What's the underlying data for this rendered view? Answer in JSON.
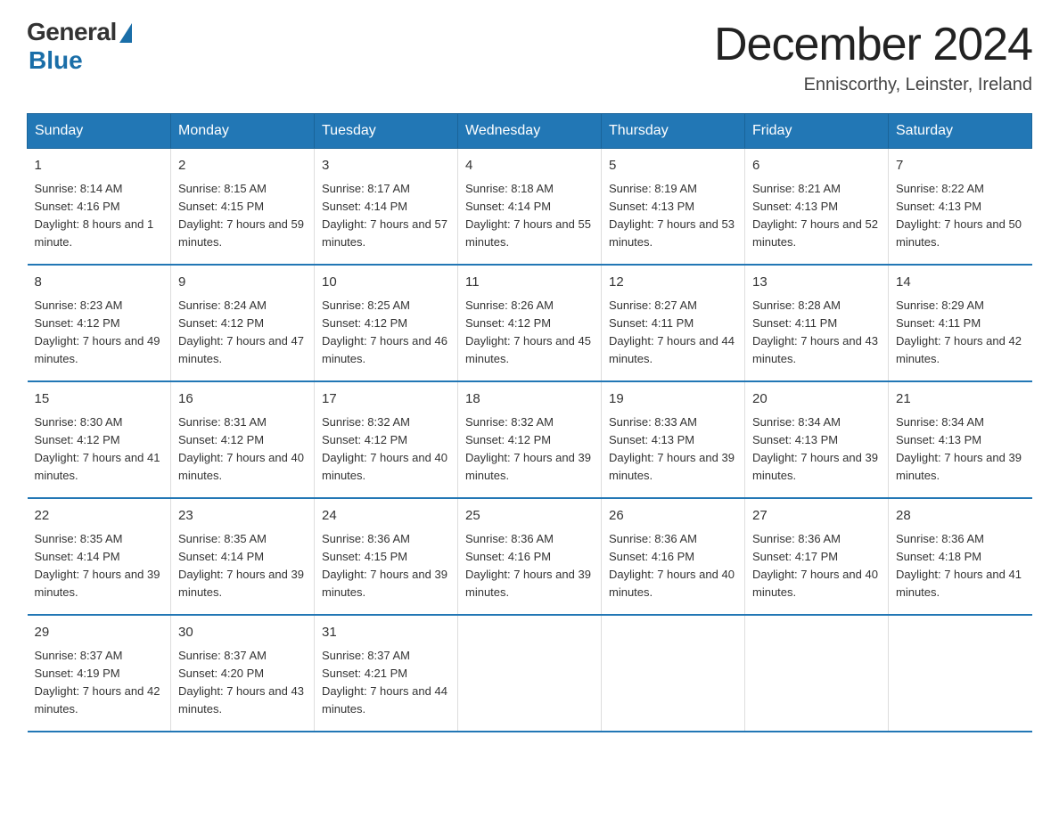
{
  "logo": {
    "general_text": "General",
    "blue_text": "Blue"
  },
  "header": {
    "month_title": "December 2024",
    "location": "Enniscorthy, Leinster, Ireland"
  },
  "weekdays": [
    "Sunday",
    "Monday",
    "Tuesday",
    "Wednesday",
    "Thursday",
    "Friday",
    "Saturday"
  ],
  "weeks": [
    [
      {
        "day": "1",
        "sunrise": "8:14 AM",
        "sunset": "4:16 PM",
        "daylight": "8 hours and 1 minute."
      },
      {
        "day": "2",
        "sunrise": "8:15 AM",
        "sunset": "4:15 PM",
        "daylight": "7 hours and 59 minutes."
      },
      {
        "day": "3",
        "sunrise": "8:17 AM",
        "sunset": "4:14 PM",
        "daylight": "7 hours and 57 minutes."
      },
      {
        "day": "4",
        "sunrise": "8:18 AM",
        "sunset": "4:14 PM",
        "daylight": "7 hours and 55 minutes."
      },
      {
        "day": "5",
        "sunrise": "8:19 AM",
        "sunset": "4:13 PM",
        "daylight": "7 hours and 53 minutes."
      },
      {
        "day": "6",
        "sunrise": "8:21 AM",
        "sunset": "4:13 PM",
        "daylight": "7 hours and 52 minutes."
      },
      {
        "day": "7",
        "sunrise": "8:22 AM",
        "sunset": "4:13 PM",
        "daylight": "7 hours and 50 minutes."
      }
    ],
    [
      {
        "day": "8",
        "sunrise": "8:23 AM",
        "sunset": "4:12 PM",
        "daylight": "7 hours and 49 minutes."
      },
      {
        "day": "9",
        "sunrise": "8:24 AM",
        "sunset": "4:12 PM",
        "daylight": "7 hours and 47 minutes."
      },
      {
        "day": "10",
        "sunrise": "8:25 AM",
        "sunset": "4:12 PM",
        "daylight": "7 hours and 46 minutes."
      },
      {
        "day": "11",
        "sunrise": "8:26 AM",
        "sunset": "4:12 PM",
        "daylight": "7 hours and 45 minutes."
      },
      {
        "day": "12",
        "sunrise": "8:27 AM",
        "sunset": "4:11 PM",
        "daylight": "7 hours and 44 minutes."
      },
      {
        "day": "13",
        "sunrise": "8:28 AM",
        "sunset": "4:11 PM",
        "daylight": "7 hours and 43 minutes."
      },
      {
        "day": "14",
        "sunrise": "8:29 AM",
        "sunset": "4:11 PM",
        "daylight": "7 hours and 42 minutes."
      }
    ],
    [
      {
        "day": "15",
        "sunrise": "8:30 AM",
        "sunset": "4:12 PM",
        "daylight": "7 hours and 41 minutes."
      },
      {
        "day": "16",
        "sunrise": "8:31 AM",
        "sunset": "4:12 PM",
        "daylight": "7 hours and 40 minutes."
      },
      {
        "day": "17",
        "sunrise": "8:32 AM",
        "sunset": "4:12 PM",
        "daylight": "7 hours and 40 minutes."
      },
      {
        "day": "18",
        "sunrise": "8:32 AM",
        "sunset": "4:12 PM",
        "daylight": "7 hours and 39 minutes."
      },
      {
        "day": "19",
        "sunrise": "8:33 AM",
        "sunset": "4:13 PM",
        "daylight": "7 hours and 39 minutes."
      },
      {
        "day": "20",
        "sunrise": "8:34 AM",
        "sunset": "4:13 PM",
        "daylight": "7 hours and 39 minutes."
      },
      {
        "day": "21",
        "sunrise": "8:34 AM",
        "sunset": "4:13 PM",
        "daylight": "7 hours and 39 minutes."
      }
    ],
    [
      {
        "day": "22",
        "sunrise": "8:35 AM",
        "sunset": "4:14 PM",
        "daylight": "7 hours and 39 minutes."
      },
      {
        "day": "23",
        "sunrise": "8:35 AM",
        "sunset": "4:14 PM",
        "daylight": "7 hours and 39 minutes."
      },
      {
        "day": "24",
        "sunrise": "8:36 AM",
        "sunset": "4:15 PM",
        "daylight": "7 hours and 39 minutes."
      },
      {
        "day": "25",
        "sunrise": "8:36 AM",
        "sunset": "4:16 PM",
        "daylight": "7 hours and 39 minutes."
      },
      {
        "day": "26",
        "sunrise": "8:36 AM",
        "sunset": "4:16 PM",
        "daylight": "7 hours and 40 minutes."
      },
      {
        "day": "27",
        "sunrise": "8:36 AM",
        "sunset": "4:17 PM",
        "daylight": "7 hours and 40 minutes."
      },
      {
        "day": "28",
        "sunrise": "8:36 AM",
        "sunset": "4:18 PM",
        "daylight": "7 hours and 41 minutes."
      }
    ],
    [
      {
        "day": "29",
        "sunrise": "8:37 AM",
        "sunset": "4:19 PM",
        "daylight": "7 hours and 42 minutes."
      },
      {
        "day": "30",
        "sunrise": "8:37 AM",
        "sunset": "4:20 PM",
        "daylight": "7 hours and 43 minutes."
      },
      {
        "day": "31",
        "sunrise": "8:37 AM",
        "sunset": "4:21 PM",
        "daylight": "7 hours and 44 minutes."
      },
      null,
      null,
      null,
      null
    ]
  ]
}
